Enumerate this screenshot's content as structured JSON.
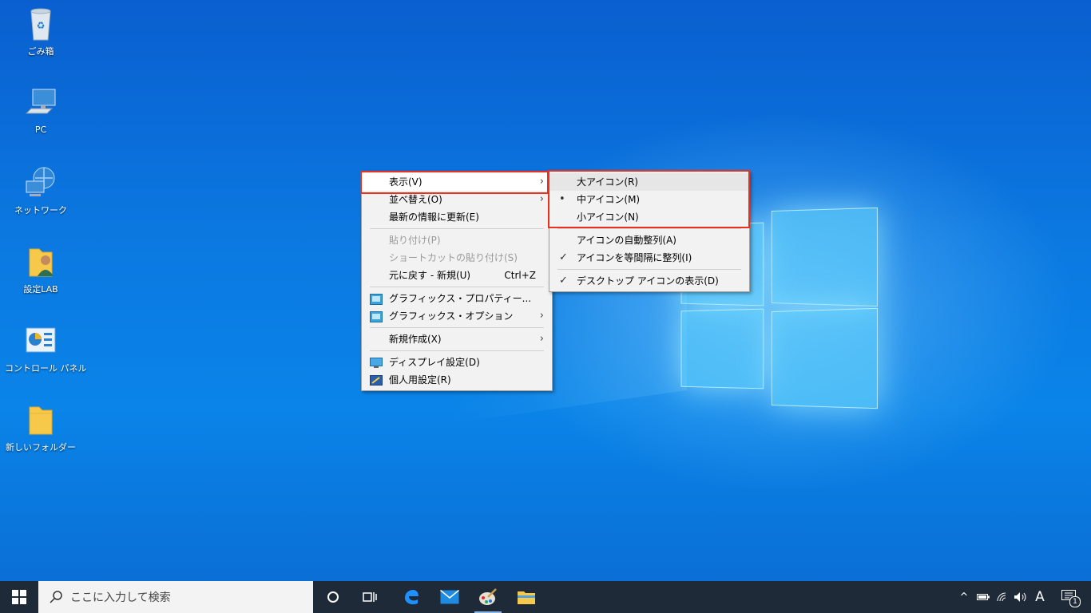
{
  "desktop": {
    "icons": [
      {
        "label": "ごみ箱",
        "icon": "recycle-bin-icon"
      },
      {
        "label": "PC",
        "icon": "computer-icon"
      },
      {
        "label": "ネットワーク",
        "icon": "network-icon"
      },
      {
        "label": "設定LAB",
        "icon": "user-folder-icon"
      },
      {
        "label": "コントロール パネル",
        "icon": "control-panel-icon"
      },
      {
        "label": "新しいフォルダー",
        "icon": "folder-icon"
      }
    ]
  },
  "context_menu": {
    "items": [
      {
        "label": "表示(V)",
        "has_submenu": true
      },
      {
        "label": "並べ替え(O)",
        "has_submenu": true
      },
      {
        "label": "最新の情報に更新(E)"
      },
      {
        "label": "貼り付け(P)",
        "disabled": true
      },
      {
        "label": "ショートカットの貼り付け(S)",
        "disabled": true
      },
      {
        "label": "元に戻す - 新規(U)",
        "shortcut": "Ctrl+Z"
      },
      {
        "label": "グラフィックス・プロパティー...",
        "icon": "graphics-icon"
      },
      {
        "label": "グラフィックス・オプション",
        "icon": "graphics-icon",
        "has_submenu": true
      },
      {
        "label": "新規作成(X)",
        "has_submenu": true
      },
      {
        "label": "ディスプレイ設定(D)",
        "icon": "display-icon"
      },
      {
        "label": "個人用設定(R)",
        "icon": "personalize-icon"
      }
    ]
  },
  "view_submenu": {
    "items": [
      {
        "label": "大アイコン(R)"
      },
      {
        "label": "中アイコン(M)",
        "selected_marker": "•"
      },
      {
        "label": "小アイコン(N)"
      },
      {
        "label": "アイコンの自動整列(A)"
      },
      {
        "label": "アイコンを等間隔に整列(I)",
        "check": "✓"
      },
      {
        "label": "デスクトップ アイコンの表示(D)",
        "check": "✓"
      }
    ]
  },
  "taskbar": {
    "search_placeholder": "ここに入力して検索",
    "ime_indicator": "A",
    "notification_count": "1",
    "pinned": [
      "cortana-icon",
      "task-view-icon",
      "edge-icon",
      "mail-icon",
      "paint-icon",
      "file-explorer-icon"
    ]
  },
  "colors": {
    "highlight_box": "#e8321e",
    "taskbar": "#1f2a38"
  }
}
